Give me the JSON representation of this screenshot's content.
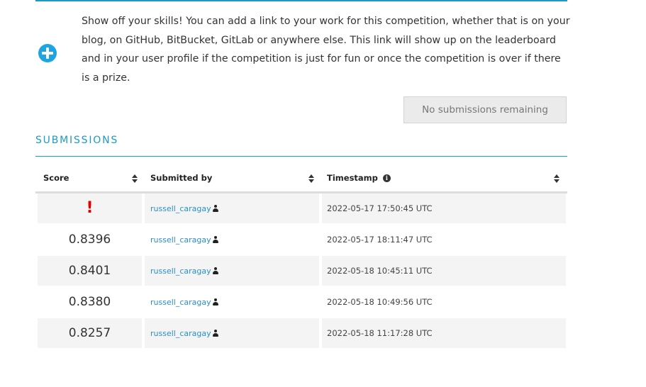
{
  "promo": {
    "text": "Show off your skills! You can add a link to your work for this competition, whether that is on your blog, on GitHub, BitBucket, GitLab or anywhere else. This link will show up on the leaderboard and in your user profile if the competition is just for fun or once the competition is over if there is a prize.",
    "icon": "plus-circle-icon"
  },
  "submit_button": {
    "label": "No submissions remaining"
  },
  "submissions": {
    "title": "SUBMISSIONS",
    "columns": {
      "score": "Score",
      "submitted_by": "Submitted by",
      "timestamp": "Timestamp"
    },
    "rows": [
      {
        "score": "!",
        "user": "russell_caragay",
        "timestamp": "2022-05-17 17:50:45 UTC"
      },
      {
        "score": "0.8396",
        "user": "russell_caragay",
        "timestamp": "2022-05-17 18:11:47 UTC"
      },
      {
        "score": "0.8401",
        "user": "russell_caragay",
        "timestamp": "2022-05-18 10:45:11 UTC"
      },
      {
        "score": "0.8380",
        "user": "russell_caragay",
        "timestamp": "2022-05-18 10:49:56 UTC"
      },
      {
        "score": "0.8257",
        "user": "russell_caragay",
        "timestamp": "2022-05-18 11:17:28 UTC"
      }
    ]
  },
  "colors": {
    "accent": "#1b9bc4",
    "link": "#2a8fc7",
    "error": "#e00000",
    "plus_icon": "#1ea4e0"
  }
}
